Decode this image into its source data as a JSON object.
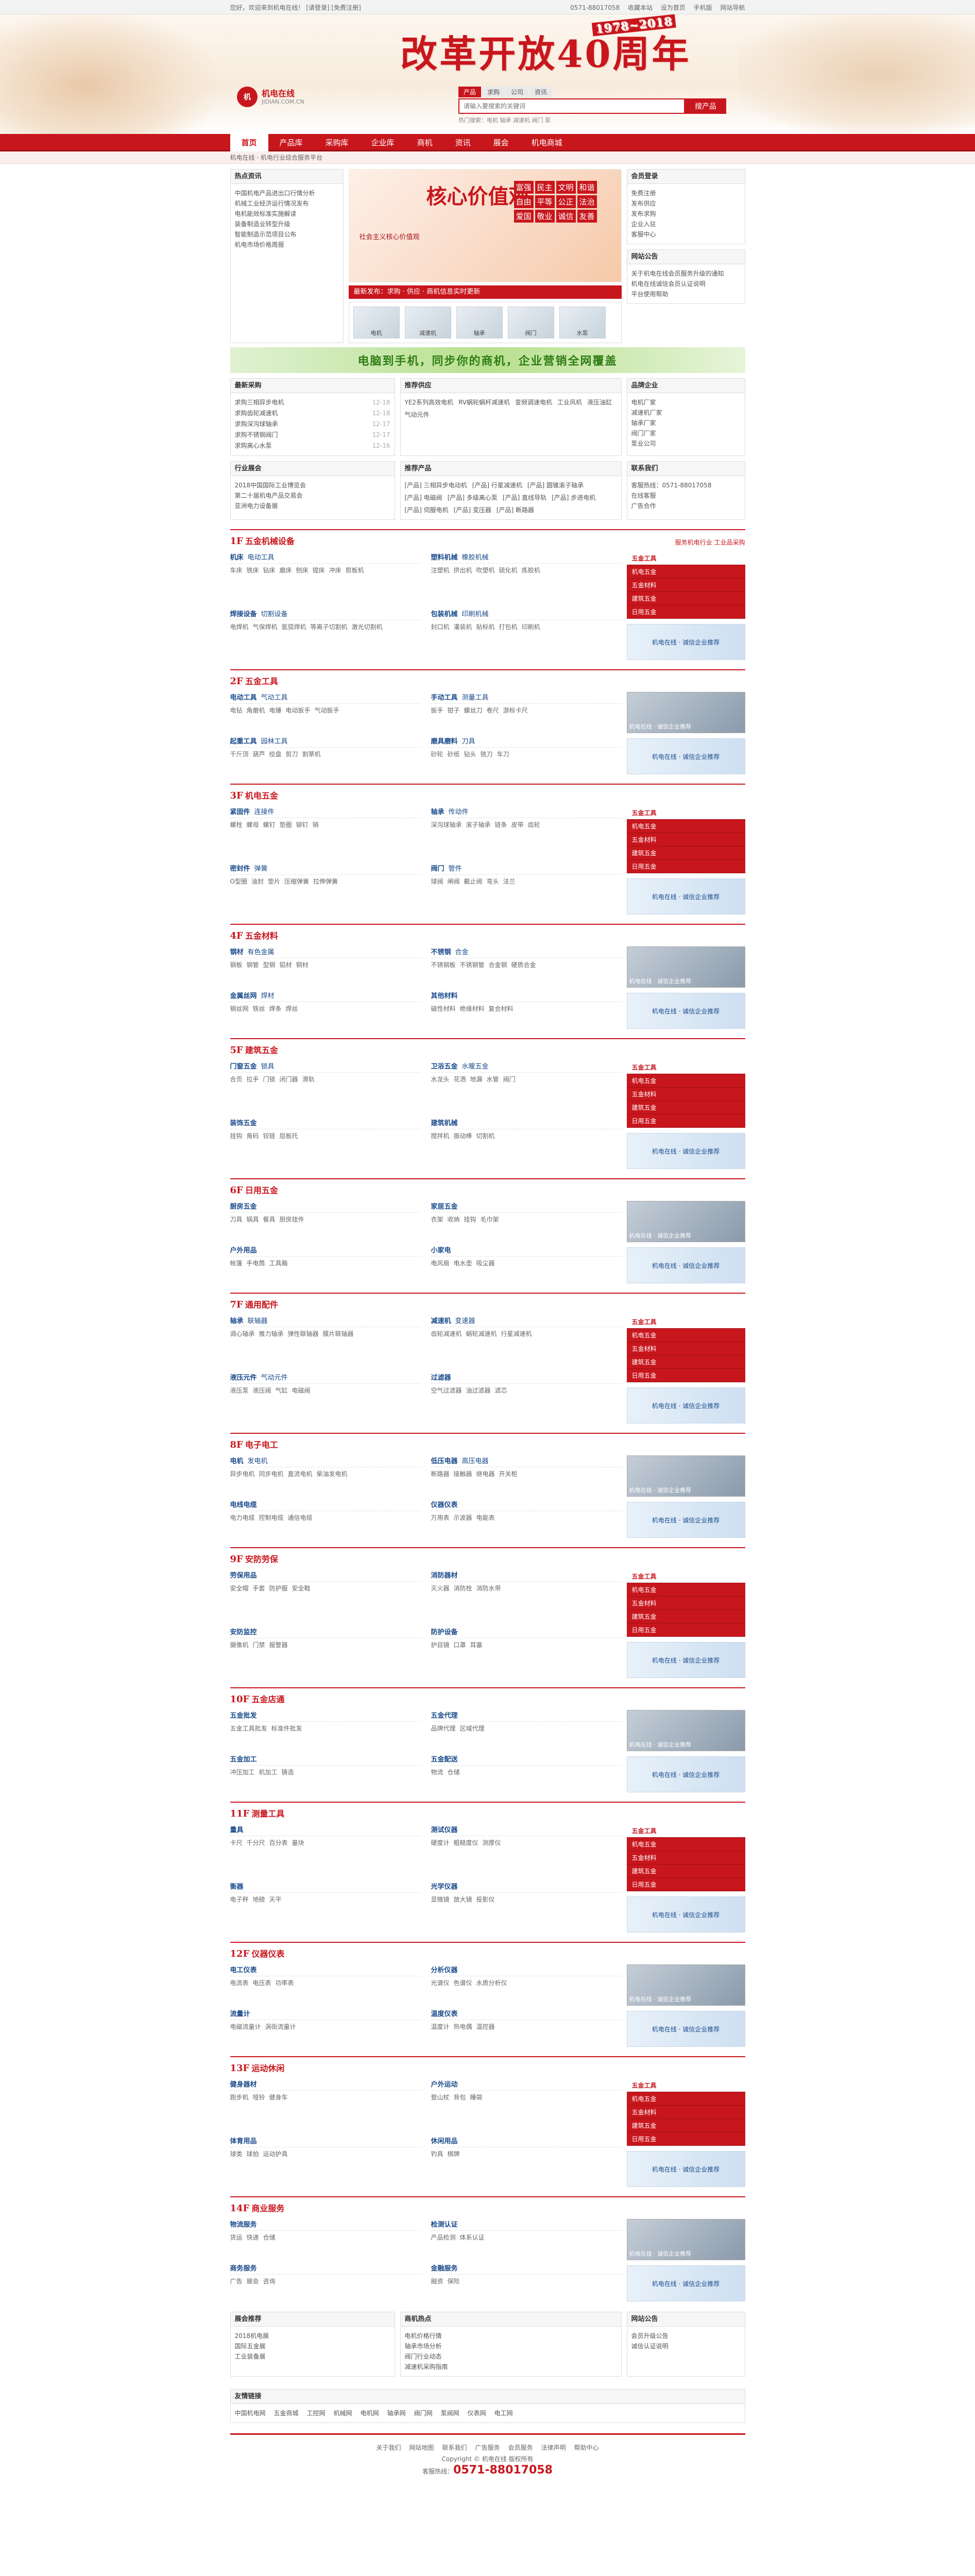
{
  "topbar": {
    "left": "您好，欢迎来到机电在线！ [请登录] [免费注册]",
    "tel": "0571-88017058",
    "links": [
      "收藏本站",
      "设为首页",
      "手机版",
      "网站导航"
    ]
  },
  "banner": {
    "title": "改革开放40周年",
    "years": "1978~2018"
  },
  "logo": {
    "mark": "机",
    "name": "机电在线",
    "sub": "JIDIAN.COM.CN"
  },
  "search": {
    "tabs": [
      "产品",
      "求购",
      "公司",
      "资讯"
    ],
    "placeholder": "请输入要搜索的关键词",
    "button": "搜产品",
    "hot": "热门搜索：电机 轴承 减速机 阀门 泵"
  },
  "nav": [
    "首页",
    "产品库",
    "采购库",
    "企业库",
    "商机",
    "资讯",
    "展会",
    "机电商城"
  ],
  "sub_strip": "机电在线 · 机电行业综合服务平台",
  "hero": {
    "left_title": "热点资讯",
    "left_items": [
      "中国机电产品进出口行情分析",
      "机械工业经济运行情况发布",
      "电机能效标准实施解读",
      "装备制造业转型升级",
      "智能制造示范项目公布",
      "机电市场价格周报"
    ],
    "ad_core": "核心价值观",
    "ad_slogan": [
      "富强",
      "民主",
      "文明",
      "和谐",
      "自由",
      "平等",
      "公正",
      "法治",
      "爱国",
      "敬业",
      "诚信",
      "友善"
    ],
    "ad_tag": "社会主义核心价值观",
    "bar": "最新发布：求购 · 供应 · 商机信息实时更新",
    "products": [
      "电机",
      "减速机",
      "轴承",
      "阀门",
      "水泵"
    ],
    "right_title": "会员登录",
    "right_items": [
      "免费注册",
      "发布供应",
      "发布求购",
      "企业入驻",
      "客服中心"
    ],
    "right_news_title": "网站公告",
    "right_news": [
      "关于机电在线会员服务升级的通知",
      "机电在线诚信会员认证说明",
      "平台使用帮助"
    ]
  },
  "green_ad": "电脑到手机，同步你的商机，企业营销全网覆盖",
  "row3": {
    "a_title": "最新采购",
    "a_items": [
      [
        "求购三相异步电机",
        "12-18"
      ],
      [
        "求购齿轮减速机",
        "12-18"
      ],
      [
        "求购深沟球轴承",
        "12-17"
      ],
      [
        "求购不锈钢阀门",
        "12-17"
      ],
      [
        "求购离心水泵",
        "12-16"
      ]
    ],
    "b_title": "推荐供应",
    "b_items": [
      "YE2系列高效电机",
      "RV蜗轮蜗杆减速机",
      "变频调速电机",
      "工业风机",
      "液压油缸",
      "气动元件"
    ],
    "c_title": "品牌企业",
    "c_items": [
      "电机厂家",
      "减速机厂家",
      "轴承厂家",
      "阀门厂家",
      "泵业公司"
    ]
  },
  "row4": {
    "a_title": "行业展会",
    "a_items": [
      "2018中国国际工业博览会",
      "第二十届机电产品交易会",
      "亚洲电力设备展"
    ],
    "b_title": "推荐产品",
    "b_items": [
      "[产品] 三相异步电动机",
      "[产品] 行星减速机",
      "[产品] 圆锥滚子轴承",
      "[产品] 电磁阀",
      "[产品] 多级离心泵",
      "[产品] 直线导轨",
      "[产品] 步进电机",
      "[产品] 伺服电机",
      "[产品] 变压器",
      "[产品] 断路器"
    ],
    "c_title": "联系我们",
    "c_items": [
      "客服热线：0571-88017058",
      "在线客服",
      "广告合作"
    ]
  },
  "sections": [
    {
      "idx": "1F",
      "title": "五金机械设备",
      "note": "服务机电行业 工业品采购",
      "cats": [
        {
          "t": "机床",
          "s": "电动工具",
          "items": [
            "车床",
            "铣床",
            "钻床",
            "磨床",
            "刨床",
            "镗床",
            "冲床",
            "剪板机"
          ]
        },
        {
          "t": "塑料机械",
          "s": "橡胶机械",
          "items": [
            "注塑机",
            "挤出机",
            "吹塑机",
            "硫化机",
            "炼胶机"
          ]
        },
        {
          "t": "焊接设备",
          "s": "切割设备",
          "items": [
            "电焊机",
            "气保焊机",
            "氩弧焊机",
            "等离子切割机",
            "激光切割机"
          ]
        },
        {
          "t": "包装机械",
          "s": "印刷机械",
          "items": [
            "封口机",
            "灌装机",
            "贴标机",
            "打包机",
            "印刷机"
          ]
        }
      ]
    },
    {
      "idx": "2F",
      "title": "五金工具",
      "note": "",
      "cats": [
        {
          "t": "电动工具",
          "s": "气动工具",
          "items": [
            "电钻",
            "角磨机",
            "电锤",
            "电动扳手",
            "气动扳手"
          ]
        },
        {
          "t": "手动工具",
          "s": "测量工具",
          "items": [
            "扳手",
            "钳子",
            "螺丝刀",
            "卷尺",
            "游标卡尺"
          ]
        },
        {
          "t": "起重工具",
          "s": "园林工具",
          "items": [
            "千斤顶",
            "葫芦",
            "绞盘",
            "剪刀",
            "割草机"
          ]
        },
        {
          "t": "磨具磨料",
          "s": "刀具",
          "items": [
            "砂轮",
            "砂纸",
            "钻头",
            "铣刀",
            "车刀"
          ]
        }
      ]
    },
    {
      "idx": "3F",
      "title": "机电五金",
      "note": "",
      "cats": [
        {
          "t": "紧固件",
          "s": "连接件",
          "items": [
            "螺栓",
            "螺母",
            "螺钉",
            "垫圈",
            "铆钉",
            "销"
          ]
        },
        {
          "t": "轴承",
          "s": "传动件",
          "items": [
            "深沟球轴承",
            "滚子轴承",
            "链条",
            "皮带",
            "齿轮"
          ]
        },
        {
          "t": "密封件",
          "s": "弹簧",
          "items": [
            "O型圈",
            "油封",
            "垫片",
            "压缩弹簧",
            "拉伸弹簧"
          ]
        },
        {
          "t": "阀门",
          "s": "管件",
          "items": [
            "球阀",
            "闸阀",
            "截止阀",
            "弯头",
            "法兰"
          ]
        }
      ]
    },
    {
      "idx": "4F",
      "title": "五金材料",
      "note": "",
      "cats": [
        {
          "t": "钢材",
          "s": "有色金属",
          "items": [
            "钢板",
            "钢管",
            "型钢",
            "铝材",
            "铜材"
          ]
        },
        {
          "t": "不锈钢",
          "s": "合金",
          "items": [
            "不锈钢板",
            "不锈钢管",
            "合金钢",
            "硬质合金"
          ]
        },
        {
          "t": "金属丝网",
          "s": "焊材",
          "items": [
            "钢丝网",
            "铁丝",
            "焊条",
            "焊丝"
          ]
        },
        {
          "t": "其他材料",
          "s": "",
          "items": [
            "磁性材料",
            "绝缘材料",
            "复合材料"
          ]
        }
      ]
    },
    {
      "idx": "5F",
      "title": "建筑五金",
      "note": "",
      "cats": [
        {
          "t": "门窗五金",
          "s": "锁具",
          "items": [
            "合页",
            "拉手",
            "门锁",
            "闭门器",
            "滑轨"
          ]
        },
        {
          "t": "卫浴五金",
          "s": "水暖五金",
          "items": [
            "水龙头",
            "花洒",
            "地漏",
            "水管",
            "阀门"
          ]
        },
        {
          "t": "装饰五金",
          "s": "",
          "items": [
            "挂钩",
            "角码",
            "铰链",
            "层板托"
          ]
        },
        {
          "t": "建筑机械",
          "s": "",
          "items": [
            "搅拌机",
            "振动棒",
            "切割机"
          ]
        }
      ]
    },
    {
      "idx": "6F",
      "title": "日用五金",
      "note": "",
      "cats": [
        {
          "t": "厨房五金",
          "s": "",
          "items": [
            "刀具",
            "锅具",
            "餐具",
            "厨房挂件"
          ]
        },
        {
          "t": "家居五金",
          "s": "",
          "items": [
            "衣架",
            "收纳",
            "挂钩",
            "毛巾架"
          ]
        },
        {
          "t": "户外用品",
          "s": "",
          "items": [
            "帐篷",
            "手电筒",
            "工具箱"
          ]
        },
        {
          "t": "小家电",
          "s": "",
          "items": [
            "电风扇",
            "电水壶",
            "吸尘器"
          ]
        }
      ]
    },
    {
      "idx": "7F",
      "title": "通用配件",
      "note": "",
      "cats": [
        {
          "t": "轴承",
          "s": "联轴器",
          "items": [
            "调心轴承",
            "推力轴承",
            "弹性联轴器",
            "膜片联轴器"
          ]
        },
        {
          "t": "减速机",
          "s": "变速器",
          "items": [
            "齿轮减速机",
            "蜗轮减速机",
            "行星减速机"
          ]
        },
        {
          "t": "液压元件",
          "s": "气动元件",
          "items": [
            "液压泵",
            "液压阀",
            "气缸",
            "电磁阀"
          ]
        },
        {
          "t": "过滤器",
          "s": "",
          "items": [
            "空气过滤器",
            "油过滤器",
            "滤芯"
          ]
        }
      ]
    },
    {
      "idx": "8F",
      "title": "电子电工",
      "note": "",
      "cats": [
        {
          "t": "电机",
          "s": "发电机",
          "items": [
            "异步电机",
            "同步电机",
            "直流电机",
            "柴油发电机"
          ]
        },
        {
          "t": "低压电器",
          "s": "高压电器",
          "items": [
            "断路器",
            "接触器",
            "继电器",
            "开关柜"
          ]
        },
        {
          "t": "电线电缆",
          "s": "",
          "items": [
            "电力电缆",
            "控制电缆",
            "通信电缆"
          ]
        },
        {
          "t": "仪器仪表",
          "s": "",
          "items": [
            "万用表",
            "示波器",
            "电能表"
          ]
        }
      ]
    },
    {
      "idx": "9F",
      "title": "安防劳保",
      "note": "",
      "cats": [
        {
          "t": "劳保用品",
          "s": "",
          "items": [
            "安全帽",
            "手套",
            "防护服",
            "安全鞋"
          ]
        },
        {
          "t": "消防器材",
          "s": "",
          "items": [
            "灭火器",
            "消防栓",
            "消防水带"
          ]
        },
        {
          "t": "安防监控",
          "s": "",
          "items": [
            "摄像机",
            "门禁",
            "报警器"
          ]
        },
        {
          "t": "防护设备",
          "s": "",
          "items": [
            "护目镜",
            "口罩",
            "耳塞"
          ]
        }
      ]
    },
    {
      "idx": "10F",
      "title": "五金店通",
      "note": "",
      "cats": [
        {
          "t": "五金批发",
          "s": "",
          "items": [
            "五金工具批发",
            "标准件批发"
          ]
        },
        {
          "t": "五金代理",
          "s": "",
          "items": [
            "品牌代理",
            "区域代理"
          ]
        },
        {
          "t": "五金加工",
          "s": "",
          "items": [
            "冲压加工",
            "机加工",
            "铸造"
          ]
        },
        {
          "t": "五金配送",
          "s": "",
          "items": [
            "物流",
            "仓储"
          ]
        }
      ]
    },
    {
      "idx": "11F",
      "title": "测量工具",
      "note": "",
      "cats": [
        {
          "t": "量具",
          "s": "",
          "items": [
            "卡尺",
            "千分尺",
            "百分表",
            "量块"
          ]
        },
        {
          "t": "测试仪器",
          "s": "",
          "items": [
            "硬度计",
            "粗糙度仪",
            "测厚仪"
          ]
        },
        {
          "t": "衡器",
          "s": "",
          "items": [
            "电子秤",
            "地磅",
            "天平"
          ]
        },
        {
          "t": "光学仪器",
          "s": "",
          "items": [
            "显微镜",
            "放大镜",
            "投影仪"
          ]
        }
      ]
    },
    {
      "idx": "12F",
      "title": "仪器仪表",
      "note": "",
      "cats": [
        {
          "t": "电工仪表",
          "s": "",
          "items": [
            "电流表",
            "电压表",
            "功率表"
          ]
        },
        {
          "t": "分析仪器",
          "s": "",
          "items": [
            "光谱仪",
            "色谱仪",
            "水质分析仪"
          ]
        },
        {
          "t": "流量计",
          "s": "",
          "items": [
            "电磁流量计",
            "涡街流量计"
          ]
        },
        {
          "t": "温度仪表",
          "s": "",
          "items": [
            "温度计",
            "热电偶",
            "温控器"
          ]
        }
      ]
    },
    {
      "idx": "13F",
      "title": "运动休闲",
      "note": "",
      "cats": [
        {
          "t": "健身器材",
          "s": "",
          "items": [
            "跑步机",
            "哑铃",
            "健身车"
          ]
        },
        {
          "t": "户外运动",
          "s": "",
          "items": [
            "登山杖",
            "背包",
            "睡袋"
          ]
        },
        {
          "t": "体育用品",
          "s": "",
          "items": [
            "球类",
            "球拍",
            "运动护具"
          ]
        },
        {
          "t": "休闲用品",
          "s": "",
          "items": [
            "钓具",
            "棋牌"
          ]
        }
      ]
    },
    {
      "idx": "14F",
      "title": "商业服务",
      "note": "",
      "cats": [
        {
          "t": "物流服务",
          "s": "",
          "items": [
            "货运",
            "快递",
            "仓储"
          ]
        },
        {
          "t": "检测认证",
          "s": "",
          "items": [
            "产品检测",
            "体系认证"
          ]
        },
        {
          "t": "商务服务",
          "s": "",
          "items": [
            "广告",
            "展会",
            "咨询"
          ]
        },
        {
          "t": "金融服务",
          "s": "",
          "items": [
            "融资",
            "保险"
          ]
        }
      ]
    }
  ],
  "side_tabs": [
    "五金工具",
    "机电五金",
    "五金材料",
    "建筑五金",
    "日用五金"
  ],
  "side_ad": "机电在线 · 诚信企业推荐",
  "bottom": {
    "a_title": "展会推荐",
    "a_items": [
      "2018机电展",
      "国际五金展",
      "工业装备展"
    ],
    "b_title": "商机热点",
    "b_items": [
      "电机价格行情",
      "轴承市场分析",
      "阀门行业动态",
      "减速机采购指南"
    ],
    "c_title": "网站公告",
    "c_items": [
      "会员升级公告",
      "诚信认证说明"
    ]
  },
  "friend": {
    "title": "友情链接",
    "items": [
      "中国机电网",
      "五金商城",
      "工控网",
      "机械网",
      "电机网",
      "轴承网",
      "阀门网",
      "泵阀网",
      "仪表网",
      "电工网"
    ]
  },
  "footer": {
    "links": [
      "关于我们",
      "网站地图",
      "联系我们",
      "广告服务",
      "会员服务",
      "法律声明",
      "帮助中心"
    ],
    "copy": "Copyright © 机电在线 版权所有",
    "tel_label": "客服热线：",
    "tel": "0571-88017058"
  }
}
